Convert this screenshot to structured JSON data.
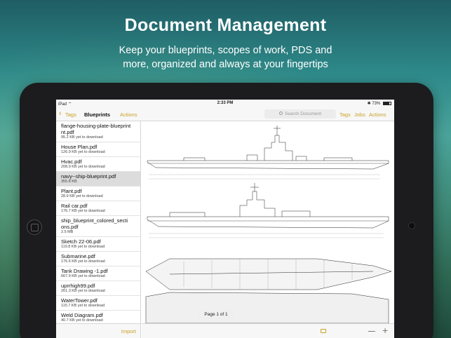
{
  "hero": {
    "title": "Document Management",
    "subtitle_line1": "Keep your blueprints, scopes of work, PDS and",
    "subtitle_line2": "more, organized and always at your fingertips"
  },
  "status_bar": {
    "device": "iPad",
    "time": "2:33 PM",
    "battery": "73%"
  },
  "nav": {
    "back_label": "Tags",
    "title": "Blueprints",
    "left_actions": "Actions",
    "search_placeholder": "Search Document",
    "right_tags": "Tags",
    "right_jobs": "Jobs",
    "right_actions": "Actions"
  },
  "files": [
    {
      "name_line1": "flange-housing-plate-blueprint",
      "name_line2": "nt.pdf",
      "meta": "95.2 KB yet to download"
    },
    {
      "name_line1": "House Plan.pdf",
      "meta": "126.9 KB yet to download"
    },
    {
      "name_line1": "Hvac.pdf",
      "meta": "208.9 KB yet to download"
    },
    {
      "name_line1": "navy--ship-blueprint.pdf",
      "meta": "355.8 KB",
      "selected": true
    },
    {
      "name_line1": "Plant.pdf",
      "meta": "28.9 KB yet to download"
    },
    {
      "name_line1": "Rail car.pdf",
      "meta": "176.7 KB yet to download"
    },
    {
      "name_line1": "ship_blueprint_colored_secti",
      "name_line2": "ons.pdf",
      "meta": "2.5 MB"
    },
    {
      "name_line1": "Sketch 22-06.pdf",
      "meta": "119.8 KB yet to download"
    },
    {
      "name_line1": "Submarine.pdf",
      "meta": "176.6 KB yet to download"
    },
    {
      "name_line1": "Tank Drawing -1.pdf",
      "meta": "667.9 KB yet to download"
    },
    {
      "name_line1": "uprrhigh99.pdf",
      "meta": "261.3 KB yet to download"
    },
    {
      "name_line1": "WaterTower.pdf",
      "meta": "115.7 KB yet to download"
    },
    {
      "name_line1": "Weld Diagram.pdf",
      "meta": "40.7 KB yet to download"
    }
  ],
  "sidebar_footer": {
    "import_label": "Import"
  },
  "viewer": {
    "page_indicator": "Page 1 of 1"
  },
  "colors": {
    "accent": "#c9a227",
    "selected_row": "#dcdcdc"
  }
}
